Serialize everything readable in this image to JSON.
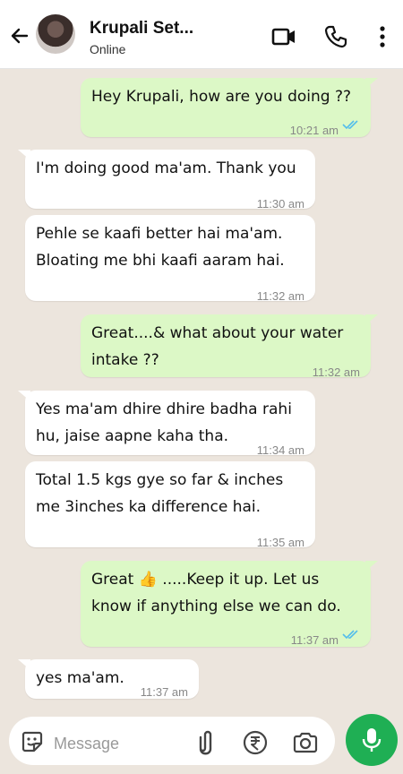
{
  "header": {
    "contact_name": "Krupali Set...",
    "status": "Online"
  },
  "messages": [
    {
      "direction": "outgoing",
      "text": "Hey Krupali, how are you doing ??",
      "time": "10:21 am",
      "read": true
    },
    {
      "direction": "incoming",
      "text": "I'm doing good ma'am. Thank you",
      "time": "11:30 am"
    },
    {
      "direction": "incoming",
      "text": "Pehle se kaafi better hai ma'am.\nBloating me bhi kaafi aaram hai.",
      "time": "11:32 am"
    },
    {
      "direction": "outgoing",
      "text": "Great....& what about your water\nintake ??",
      "time": "11:32 am"
    },
    {
      "direction": "incoming",
      "text": "Yes ma'am dhire dhire badha rahi\nhu, jaise aapne kaha tha.",
      "time": "11:34 am"
    },
    {
      "direction": "incoming",
      "text": "Total 1.5 kgs gye so far & inches\nme 3inches ka difference hai.",
      "time": "11:35 am"
    },
    {
      "direction": "outgoing",
      "text": "Great 👍 .....Keep it up. Let us\nknow if anything else we can do.",
      "time": "11:37 am",
      "read": true
    },
    {
      "direction": "incoming",
      "text": "yes ma'am.",
      "time": "11:37 am"
    }
  ],
  "composer": {
    "placeholder": "Message"
  },
  "colors": {
    "background": "#ece5dd",
    "outgoing_bubble": "#dcf8c6",
    "incoming_bubble": "#ffffff",
    "mic_button": "#1faf54",
    "read_ticks": "#53bdeb"
  },
  "icons": {
    "header": [
      "back-arrow-icon",
      "video-call-icon",
      "phone-icon",
      "more-options-icon"
    ],
    "composer": [
      "sticker-icon",
      "attach-icon",
      "rupee-payment-icon",
      "camera-icon",
      "microphone-icon"
    ]
  }
}
